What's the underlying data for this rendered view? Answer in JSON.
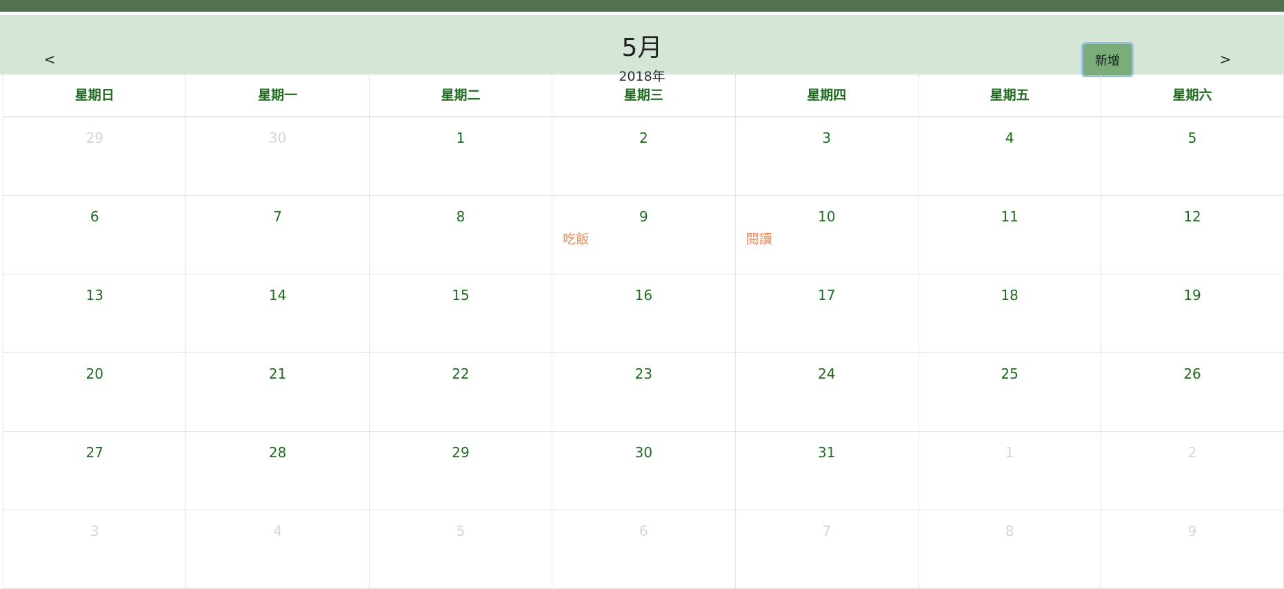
{
  "header": {
    "prev_label": "<",
    "next_label": ">",
    "month": "5月",
    "year": "2018年",
    "add_label": "新增"
  },
  "colors": {
    "top_bar": "#507250",
    "header_bg": "#d5e6d7",
    "day_number": "#1f6b1f",
    "muted_day": "#d6d6d6",
    "event_text": "#ef8a5f",
    "add_button_bg": "#7bad7b",
    "add_button_border": "#9bc1e0"
  },
  "weekdays": [
    "星期日",
    "星期一",
    "星期二",
    "星期三",
    "星期四",
    "星期五",
    "星期六"
  ],
  "weeks": [
    [
      {
        "day": "29",
        "muted": true
      },
      {
        "day": "30",
        "muted": true
      },
      {
        "day": "1"
      },
      {
        "day": "2"
      },
      {
        "day": "3"
      },
      {
        "day": "4"
      },
      {
        "day": "5"
      }
    ],
    [
      {
        "day": "6"
      },
      {
        "day": "7"
      },
      {
        "day": "8"
      },
      {
        "day": "9",
        "event": "吃飯"
      },
      {
        "day": "10",
        "event": "閱讀"
      },
      {
        "day": "11"
      },
      {
        "day": "12"
      }
    ],
    [
      {
        "day": "13"
      },
      {
        "day": "14"
      },
      {
        "day": "15"
      },
      {
        "day": "16"
      },
      {
        "day": "17"
      },
      {
        "day": "18"
      },
      {
        "day": "19"
      }
    ],
    [
      {
        "day": "20"
      },
      {
        "day": "21"
      },
      {
        "day": "22"
      },
      {
        "day": "23"
      },
      {
        "day": "24"
      },
      {
        "day": "25"
      },
      {
        "day": "26"
      }
    ],
    [
      {
        "day": "27"
      },
      {
        "day": "28"
      },
      {
        "day": "29"
      },
      {
        "day": "30"
      },
      {
        "day": "31"
      },
      {
        "day": "1",
        "muted": true
      },
      {
        "day": "2",
        "muted": true
      }
    ],
    [
      {
        "day": "3",
        "muted": true
      },
      {
        "day": "4",
        "muted": true
      },
      {
        "day": "5",
        "muted": true
      },
      {
        "day": "6",
        "muted": true
      },
      {
        "day": "7",
        "muted": true
      },
      {
        "day": "8",
        "muted": true
      },
      {
        "day": "9",
        "muted": true
      }
    ]
  ]
}
